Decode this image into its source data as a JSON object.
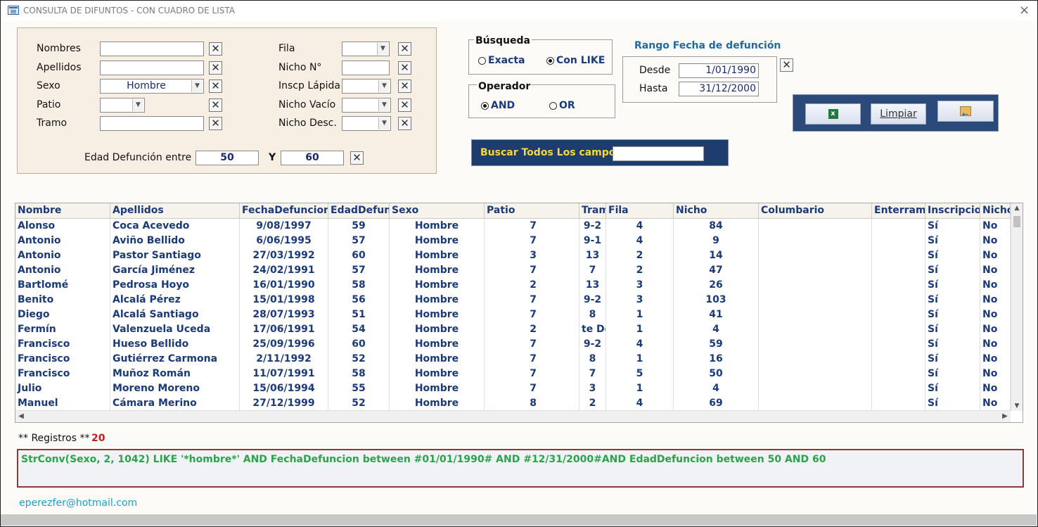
{
  "window": {
    "title": "CONSULTA DE DIFUNTOS -  CON CUADRO DE LISTA",
    "close_glyph": "×"
  },
  "filters": {
    "nombres": {
      "label": "Nombres",
      "value": ""
    },
    "apellidos": {
      "label": "Apellidos",
      "value": ""
    },
    "sexo": {
      "label": "Sexo",
      "value": "Hombre"
    },
    "patio": {
      "label": "Patio",
      "value": ""
    },
    "tramo": {
      "label": "Tramo",
      "value": ""
    },
    "fila": {
      "label": "Fila",
      "value": ""
    },
    "nicho_n": {
      "label": "Nicho N°",
      "value": ""
    },
    "inscp_lapida": {
      "label": "Inscp Lápida",
      "value": ""
    },
    "nicho_vacio": {
      "label": "Nicho Vacío",
      "value": ""
    },
    "nicho_desc": {
      "label": "Nicho Desc.",
      "value": ""
    },
    "edad": {
      "label": "Edad Defunción entre",
      "from": "50",
      "and_label": "Y",
      "to": "60"
    },
    "clear_glyph": "✕"
  },
  "busqueda": {
    "title": "Búsqueda",
    "options": [
      {
        "label": "Exacta",
        "selected": false
      },
      {
        "label": "Con LIKE",
        "selected": true
      }
    ]
  },
  "operador": {
    "title": "Operador",
    "options": [
      {
        "label": "AND",
        "selected": true
      },
      {
        "label": "OR",
        "selected": false
      }
    ]
  },
  "rango": {
    "title": "Rango Fecha de defunción",
    "desde_label": "Desde",
    "desde": "1/01/1990",
    "hasta_label": "Hasta",
    "hasta": "31/12/2000"
  },
  "toolbar": {
    "excel_icon": "excel-icon",
    "excel_glyph": "x",
    "limpiar_label": "Limpiar",
    "exit_icon": "exit-icon"
  },
  "buscar": {
    "label": "Buscar Todos Los campos",
    "value": ""
  },
  "grid": {
    "columns": [
      "Nombre",
      "Apellidos",
      "FechaDefuncion",
      "EdadDefuncion",
      "Sexo",
      "Patio",
      "Tramo",
      "Fila",
      "Nicho",
      "Columbario",
      "Enterramiento",
      "Inscripcion",
      "NichoVacio"
    ],
    "rows": [
      [
        "Alonso",
        "Coca Acevedo",
        "9/08/1997",
        "59",
        "Hombre",
        "7",
        "9-2",
        "4",
        "84",
        "",
        "",
        "Sí",
        "No"
      ],
      [
        "Antonio",
        "Aviño Bellido",
        "6/06/1995",
        "57",
        "Hombre",
        "7",
        "9-1",
        "4",
        "9",
        "",
        "",
        "Sí",
        "No"
      ],
      [
        "Antonio",
        "Pastor Santiago",
        "27/03/1992",
        "60",
        "Hombre",
        "3",
        "13",
        "2",
        "14",
        "",
        "",
        "Sí",
        "No"
      ],
      [
        "Antonio",
        "García Jiménez",
        "24/02/1991",
        "57",
        "Hombre",
        "7",
        "7",
        "2",
        "47",
        "",
        "",
        "Sí",
        "No"
      ],
      [
        "Bartlomé",
        "Pedrosa Hoyo",
        "16/01/1990",
        "58",
        "Hombre",
        "2",
        "13",
        "3",
        "26",
        "",
        "",
        "Sí",
        "No"
      ],
      [
        "Benito",
        "Alcalá Pérez",
        "15/01/1998",
        "56",
        "Hombre",
        "7",
        "9-2",
        "3",
        "103",
        "",
        "",
        "Sí",
        "No"
      ],
      [
        "Diego",
        "Alcalá Santiago",
        "28/07/1993",
        "51",
        "Hombre",
        "7",
        "8",
        "1",
        "41",
        "",
        "",
        "Sí",
        "No"
      ],
      [
        "Fermín",
        "Valenzuela Uceda",
        "17/06/1991",
        "54",
        "Hombre",
        "2",
        "te De",
        "1",
        "4",
        "",
        "",
        "Sí",
        "No"
      ],
      [
        "Francisco",
        "Hueso Bellido",
        "25/09/1996",
        "60",
        "Hombre",
        "7",
        "9-2",
        "4",
        "59",
        "",
        "",
        "Sí",
        "No"
      ],
      [
        "Francisco",
        "Gutiérrez Carmona",
        "2/11/1992",
        "52",
        "Hombre",
        "7",
        "8",
        "1",
        "16",
        "",
        "",
        "Sí",
        "No"
      ],
      [
        "Francisco",
        "Muñoz Román",
        "11/07/1991",
        "58",
        "Hombre",
        "7",
        "7",
        "5",
        "50",
        "",
        "",
        "Sí",
        "No"
      ],
      [
        "Julio",
        "Moreno Moreno",
        "15/06/1994",
        "55",
        "Hombre",
        "7",
        "3",
        "1",
        "4",
        "",
        "",
        "Sí",
        "No"
      ],
      [
        "Manuel",
        "Cámara Merino",
        "27/12/1999",
        "52",
        "Hombre",
        "8",
        "2",
        "4",
        "69",
        "",
        "",
        "Sí",
        "No"
      ]
    ]
  },
  "footer": {
    "registros_label": "** Registros **",
    "registros_count": "20",
    "sql": "StrConv(Sexo, 2, 1042) LIKE '*hombre*'  AND FechaDefuncion between #01/01/1990# AND #12/31/2000#AND  EdadDefuncion between 50 AND 60",
    "email": "eperezfer@hotmail.com"
  }
}
